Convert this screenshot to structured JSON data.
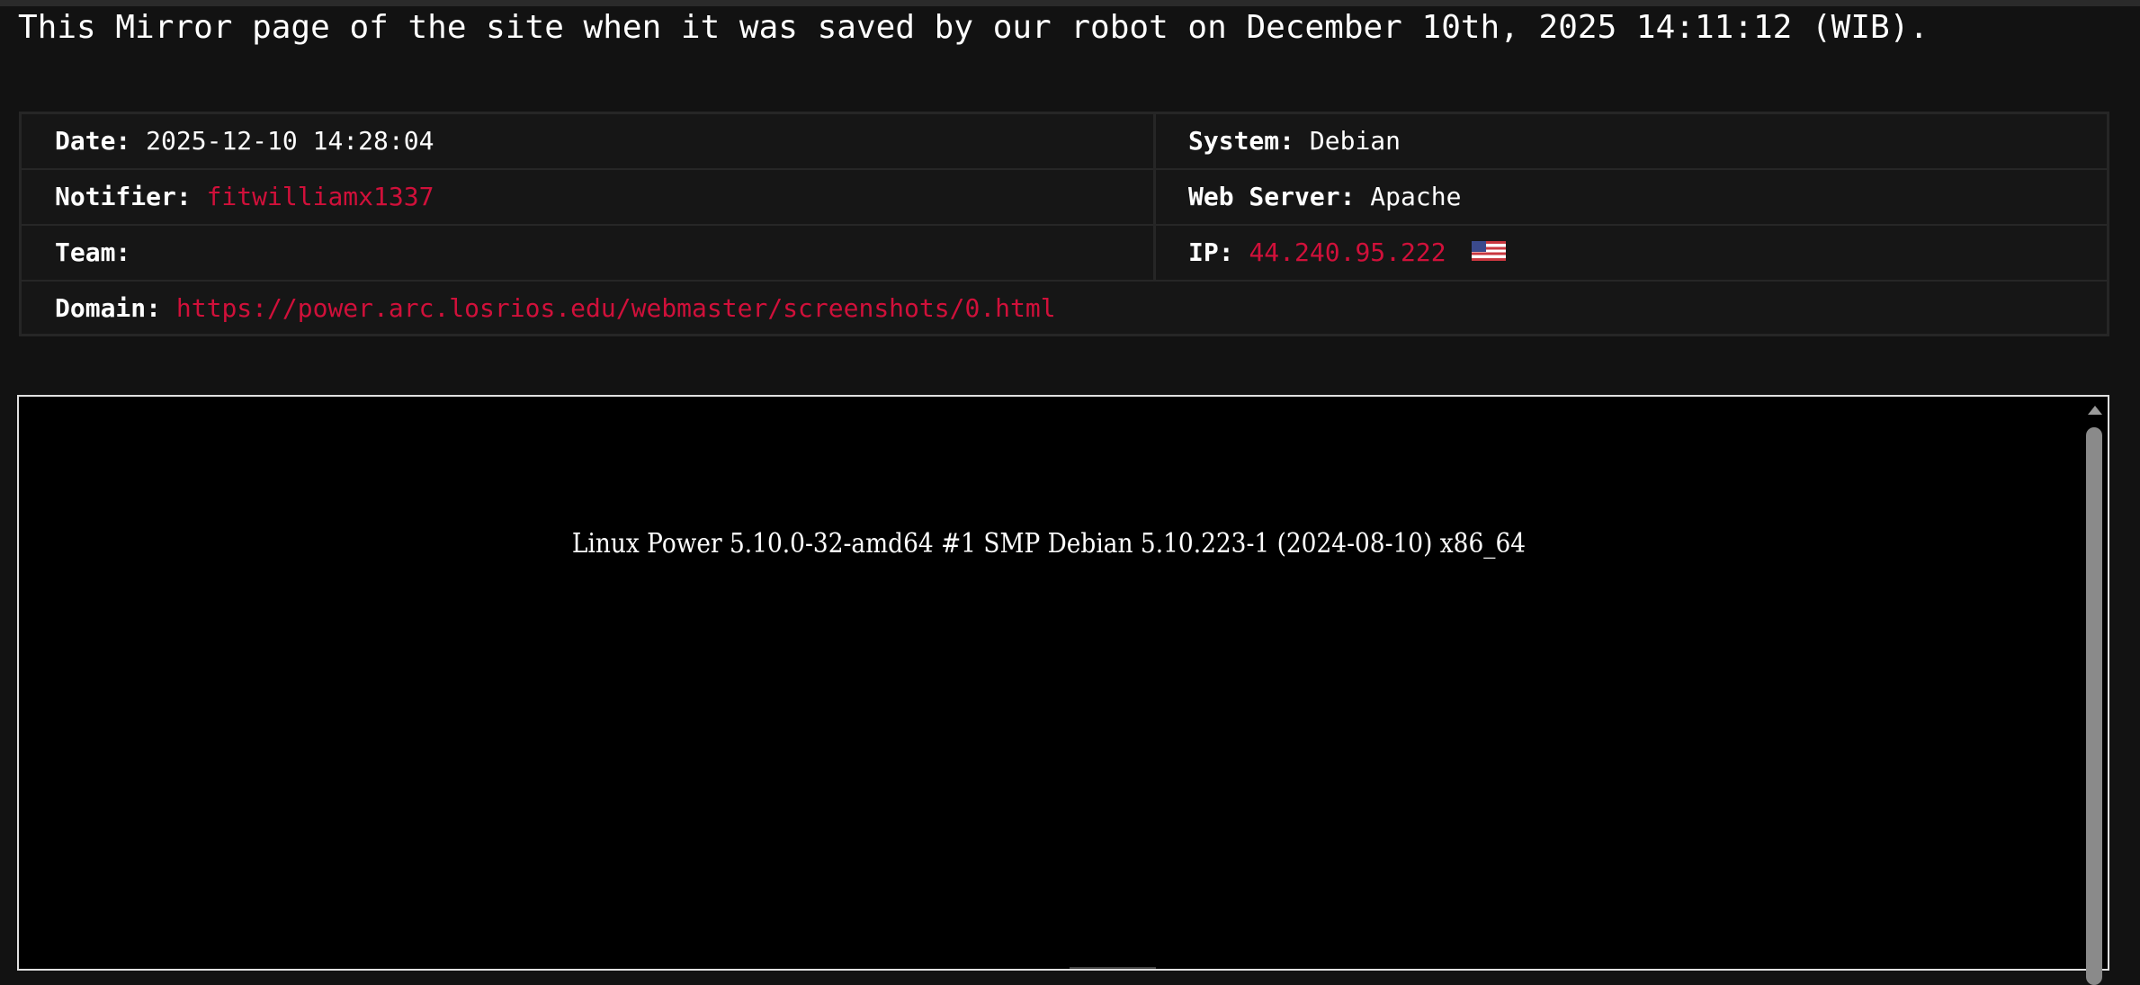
{
  "notice": "This Mirror page of the site when it was saved by our robot on December 10th, 2025 14:11:12 (WIB).",
  "info": {
    "date_label": "Date:",
    "date_value": "2025-12-10 14:28:04",
    "system_label": "System:",
    "system_value": "Debian",
    "notifier_label": "Notifier:",
    "notifier_value": "fitwilliamx1337",
    "webserver_label": "Web Server:",
    "webserver_value": "Apache",
    "team_label": "Team:",
    "team_value": "",
    "ip_label": "IP:",
    "ip_value": "44.240.95.222",
    "ip_flag": "us-flag-icon",
    "domain_label": "Domain:",
    "domain_value": "https://power.arc.losrios.edu/webmaster/screenshots/0.html"
  },
  "mirror": {
    "content_text": "Linux Power 5.10.0-32-amd64 #1 SMP Debian 5.10.223-1 (2024-08-10) x86_64"
  },
  "colors": {
    "background": "#121212",
    "link": "#d0103a",
    "mirror_bg": "#000000"
  }
}
